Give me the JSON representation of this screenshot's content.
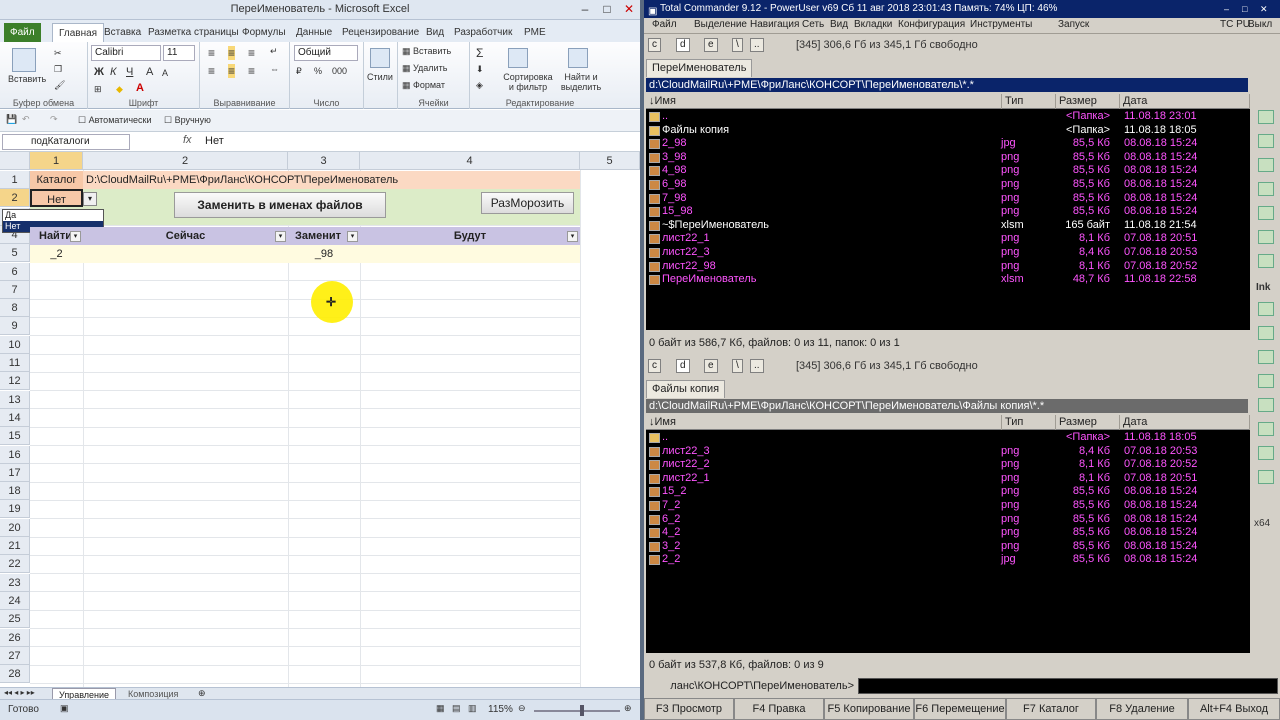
{
  "excel": {
    "title": "ПереИменователь - Microsoft Excel",
    "tabs": [
      "Файл",
      "Главная",
      "Вставка",
      "Разметка страницы",
      "Формулы",
      "Данные",
      "Рецензирование",
      "Вид",
      "Разработчик",
      "PME"
    ],
    "ribbon": {
      "groups": [
        "Буфер обмена",
        "Шрифт",
        "Выравнивание",
        "Число",
        "Ячейки",
        "Редактирование"
      ],
      "paste": "Вставить",
      "font_name": "Calibri",
      "font_size": "11",
      "number_format": "Общий",
      "styles": "Стили",
      "insert": "Вставить",
      "delete": "Удалить",
      "format": "Формат",
      "sort": "Сортировка и фильтр",
      "find": "Найти и выделить"
    },
    "qat": {
      "auto": "Автоматически",
      "manual": "Вручную"
    },
    "name_box": "подКаталоги",
    "formula": "Нет",
    "columns": [
      "1",
      "2",
      "3",
      "4",
      "5"
    ],
    "rows": [
      "1",
      "2",
      "3",
      "4",
      "5",
      "6",
      "7",
      "8",
      "9",
      "10",
      "11",
      "12",
      "13",
      "14",
      "15",
      "16",
      "17",
      "18",
      "19",
      "20",
      "21",
      "22",
      "23",
      "24",
      "25",
      "26",
      "27",
      "28"
    ],
    "cells": {
      "a1": "Каталог",
      "b1": "D:\\CloudMailRu\\+PME\\ФриЛанс\\КОНСОРТ\\ПереИменователь",
      "a2": "Нет",
      "dropdown": [
        "Да",
        "Нет"
      ],
      "btn_replace": "Заменить в именах файлов",
      "btn_unfreeze": "РазМорозить",
      "h_find": "Найти",
      "h_now": "Сейчас",
      "h_replace": "Заменит",
      "h_will": "Будут",
      "a5": "_2",
      "c5": "_98"
    },
    "sheets": [
      "Управление",
      "Композиция"
    ],
    "status": "Готово",
    "zoom": "115%"
  },
  "tc": {
    "title": "Total Commander 9.12 - PowerUser v69   Сб 11 авг 2018   23:01:43   Память: 74%   ЦП: 46%",
    "menu": [
      "Файл",
      "Выделение",
      "Навигация",
      "Сеть",
      "Вид",
      "Вкладки",
      "Конфигурация",
      "Инструменты",
      "Запуск",
      "TC PU",
      "Выкл"
    ],
    "drive_info": "[345]  306,6 Гб из 345,1 Гб свободно",
    "drives": [
      "c",
      "d",
      "e",
      "\\",
      ".."
    ],
    "col_headers": [
      "↓Имя",
      "Тип",
      "Размер",
      "Дата"
    ],
    "left": {
      "tab": "ПереИменователь",
      "path": "d:\\CloudMailRu\\+PME\\ФриЛанс\\КОНСОРТ\\ПереИменователь\\*.*",
      "files": [
        {
          "name": "..",
          "type": "",
          "size": "<Папка>",
          "date": "11.08.18 23:01",
          "color": "#ff55ff"
        },
        {
          "name": "Файлы копия",
          "type": "",
          "size": "<Папка>",
          "date": "11.08.18 18:05",
          "color": "#ffffff"
        },
        {
          "name": "2_98",
          "type": "jpg",
          "size": "85,5 Кб",
          "date": "08.08.18 15:24",
          "color": "#ff55ff"
        },
        {
          "name": "3_98",
          "type": "png",
          "size": "85,5 Кб",
          "date": "08.08.18 15:24",
          "color": "#ff55ff"
        },
        {
          "name": "4_98",
          "type": "png",
          "size": "85,5 Кб",
          "date": "08.08.18 15:24",
          "color": "#ff55ff"
        },
        {
          "name": "6_98",
          "type": "png",
          "size": "85,5 Кб",
          "date": "08.08.18 15:24",
          "color": "#ff55ff"
        },
        {
          "name": "7_98",
          "type": "png",
          "size": "85,5 Кб",
          "date": "08.08.18 15:24",
          "color": "#ff55ff"
        },
        {
          "name": "15_98",
          "type": "png",
          "size": "85,5 Кб",
          "date": "08.08.18 15:24",
          "color": "#ff55ff"
        },
        {
          "name": "~$ПереИменователь",
          "type": "xlsm",
          "size": "165 байт",
          "date": "11.08.18 21:54",
          "color": "#ffffff"
        },
        {
          "name": "лист22_1",
          "type": "png",
          "size": "8,1 Кб",
          "date": "07.08.18 20:51",
          "color": "#ff55ff"
        },
        {
          "name": "лист22_3",
          "type": "png",
          "size": "8,4 Кб",
          "date": "07.08.18 20:53",
          "color": "#ff55ff"
        },
        {
          "name": "лист22_98",
          "type": "png",
          "size": "8,1 Кб",
          "date": "07.08.18 20:52",
          "color": "#ff55ff"
        },
        {
          "name": "ПереИменователь",
          "type": "xlsm",
          "size": "48,7 Кб",
          "date": "11.08.18 22:58",
          "color": "#ff55ff"
        }
      ],
      "status": "0 байт из 586,7 Кб, файлов: 0 из 11, папок: 0 из 1"
    },
    "right": {
      "tab": "Файлы копия",
      "path": "d:\\CloudMailRu\\+PME\\ФриЛанс\\КОНСОРТ\\ПереИменователь\\Файлы копия\\*.*",
      "files": [
        {
          "name": "..",
          "type": "",
          "size": "<Папка>",
          "date": "11.08.18 18:05",
          "color": "#ff55ff"
        },
        {
          "name": "лист22_3",
          "type": "png",
          "size": "8,4 Кб",
          "date": "07.08.18 20:53",
          "color": "#ff55ff"
        },
        {
          "name": "лист22_2",
          "type": "png",
          "size": "8,1 Кб",
          "date": "07.08.18 20:52",
          "color": "#ff55ff"
        },
        {
          "name": "лист22_1",
          "type": "png",
          "size": "8,1 Кб",
          "date": "07.08.18 20:51",
          "color": "#ff55ff"
        },
        {
          "name": "15_2",
          "type": "png",
          "size": "85,5 Кб",
          "date": "08.08.18 15:24",
          "color": "#ff55ff"
        },
        {
          "name": "7_2",
          "type": "png",
          "size": "85,5 Кб",
          "date": "08.08.18 15:24",
          "color": "#ff55ff"
        },
        {
          "name": "6_2",
          "type": "png",
          "size": "85,5 Кб",
          "date": "08.08.18 15:24",
          "color": "#ff55ff"
        },
        {
          "name": "4_2",
          "type": "png",
          "size": "85,5 Кб",
          "date": "08.08.18 15:24",
          "color": "#ff55ff"
        },
        {
          "name": "3_2",
          "type": "png",
          "size": "85,5 Кб",
          "date": "08.08.18 15:24",
          "color": "#ff55ff"
        },
        {
          "name": "2_2",
          "type": "jpg",
          "size": "85,5 Кб",
          "date": "08.08.18 15:24",
          "color": "#ff55ff"
        }
      ],
      "status": "0 байт из 537,8 Кб, файлов: 0 из 9"
    },
    "cmd_prompt": "ланс\\КОНСОРТ\\ПереИменователь>",
    "fkeys": [
      "F3 Просмотр",
      "F4 Правка",
      "F5 Копирование",
      "F6 Перемещение",
      "F7 Каталог",
      "F8 Удаление",
      "Alt+F4 Выход"
    ],
    "side_labels": {
      "ink": "Ink",
      "x64": "x64"
    },
    "colors": {
      "file_pink": "#ff55ff",
      "folder_white": "#ffffff",
      "panel_bg": "#000000",
      "path_bg": "#6b6b6b"
    }
  }
}
